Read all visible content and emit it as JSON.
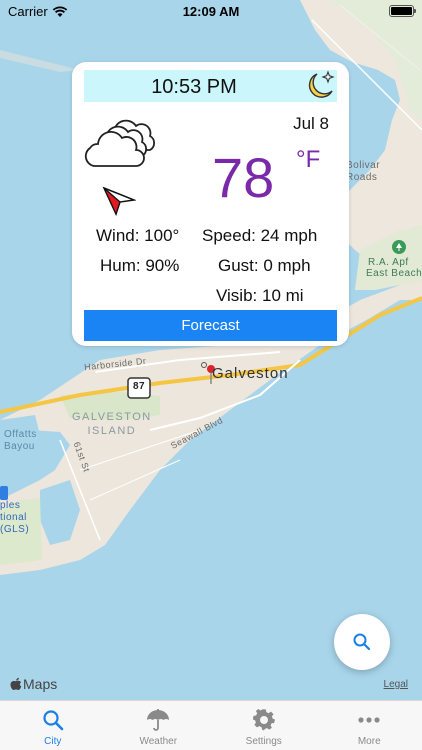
{
  "status_bar": {
    "carrier": "Carrier",
    "time": "12:09 AM"
  },
  "map": {
    "labels": {
      "bolivar_roads": "Bolivar\nRoads",
      "ra_apffel": "R.A. Apf",
      "east_beach": "East Beach",
      "harborside": "Harborside Dr",
      "galveston": "Galveston",
      "highway": "87",
      "galveston_island": "GALVESTON\nISLAND",
      "seawall": "Seawall Blvd",
      "offatts": "Offatts\nBayou",
      "street_61": "61st St",
      "airport": "ples\ntional\n(GLS)"
    },
    "attribution": "Maps",
    "legal": "Legal"
  },
  "weather_card": {
    "time": "10:53 PM",
    "date": "Jul 8",
    "temperature": "78",
    "unit": "°F",
    "wind": "Wind: 100°",
    "humidity": "Hum: 90%",
    "speed": "Speed: 24 mph",
    "gust": "Gust: 0 mph",
    "visibility": "Visib: 10 mi",
    "forecast_label": "Forecast",
    "condition_icon": "cloudy-icon",
    "night_icon": "moon-stars-icon",
    "wind_direction_icon": "wind-arrow-icon",
    "accent_color": "#7a2aa8",
    "button_color": "#1a84f5"
  },
  "tabs": [
    {
      "label": "City",
      "icon": "search-icon",
      "active": true
    },
    {
      "label": "Weather",
      "icon": "umbrella-icon",
      "active": false
    },
    {
      "label": "Settings",
      "icon": "gear-icon",
      "active": false
    },
    {
      "label": "More",
      "icon": "more-icon",
      "active": false
    }
  ]
}
